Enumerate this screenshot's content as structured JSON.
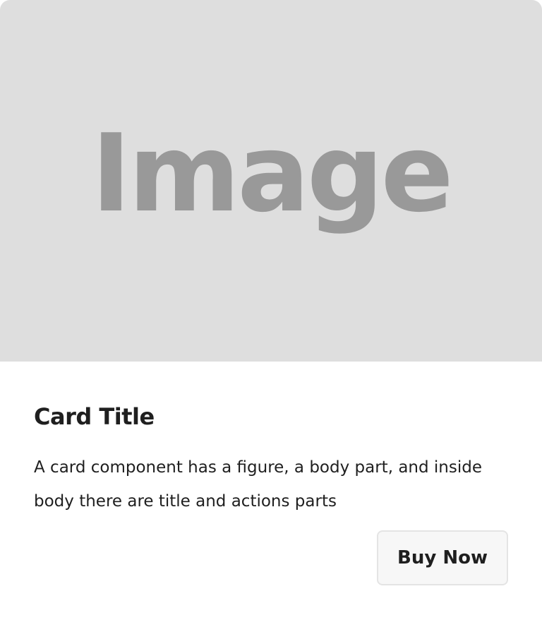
{
  "card": {
    "figure": {
      "placeholder_text": "Image",
      "background_color": "#dedede",
      "text_color": "#999999"
    },
    "title": "Card Title",
    "description": "A card component has a figure, a body part, and inside body there are title and actions parts",
    "actions": {
      "buy_label": "Buy Now"
    }
  }
}
